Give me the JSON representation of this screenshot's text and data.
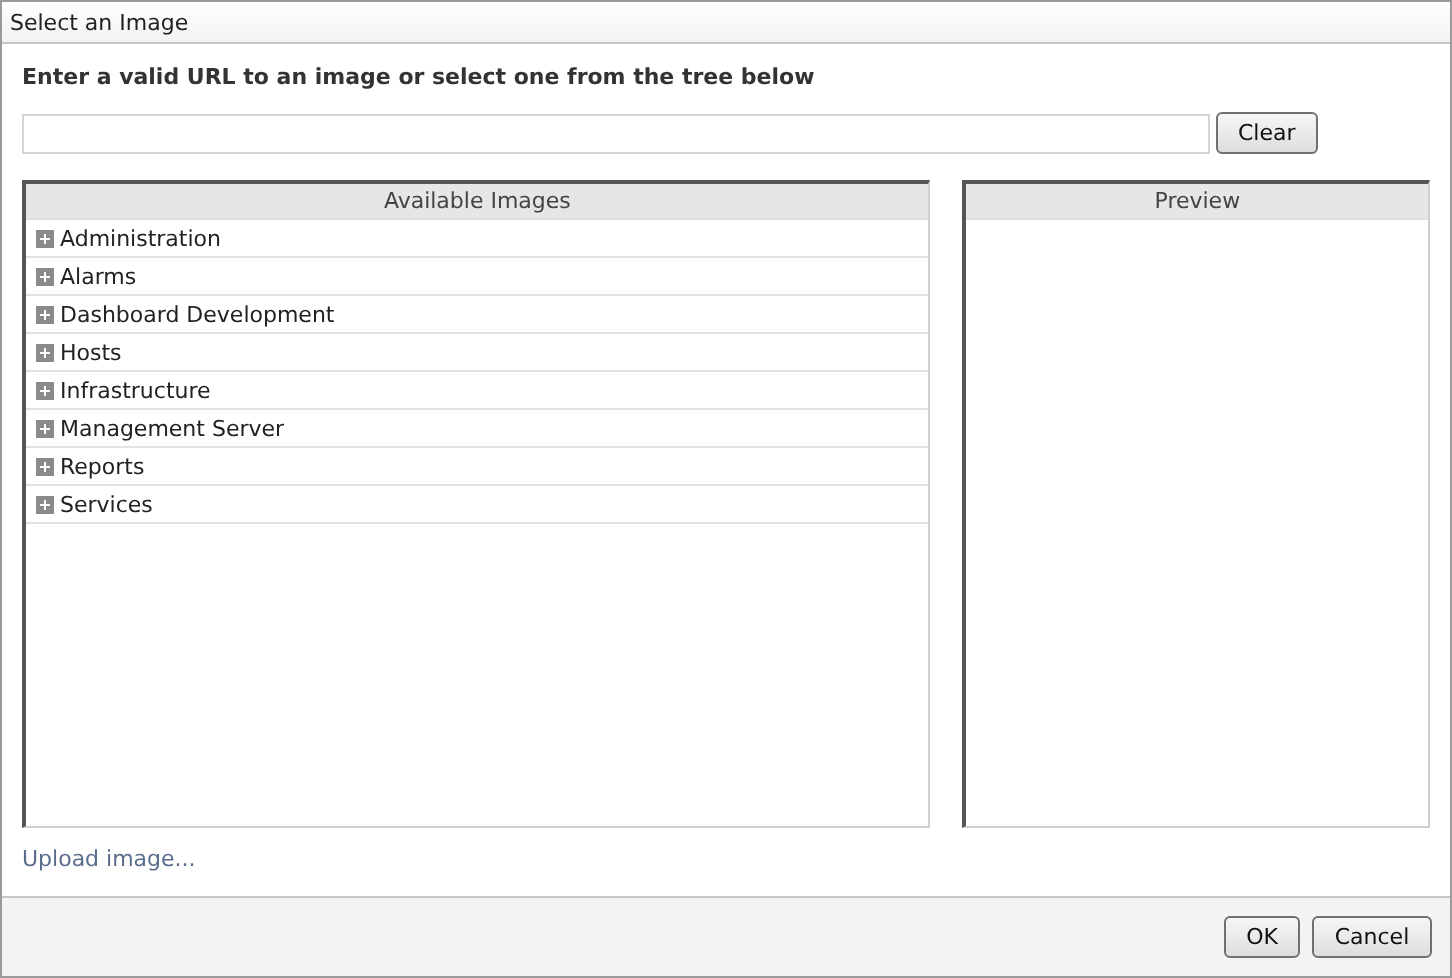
{
  "window": {
    "title": "Select an Image"
  },
  "instruction": "Enter a valid URL to an image or select one from the tree below",
  "clear_button": "Clear",
  "tree": {
    "header": "Available Images",
    "items": [
      {
        "label": "Administration",
        "expanded": false
      },
      {
        "label": "Alarms",
        "expanded": false
      },
      {
        "label": "Dashboard Development",
        "expanded": false
      },
      {
        "label": "Hosts",
        "expanded": false
      },
      {
        "label": "Infrastructure",
        "expanded": false
      },
      {
        "label": "Management Server",
        "expanded": false
      },
      {
        "label": "Reports",
        "expanded": false
      },
      {
        "label": "Services",
        "expanded": false
      }
    ]
  },
  "preview": {
    "header": "Preview"
  },
  "upload_link": "Upload image...",
  "buttons": [
    "OK",
    "Cancel"
  ]
}
